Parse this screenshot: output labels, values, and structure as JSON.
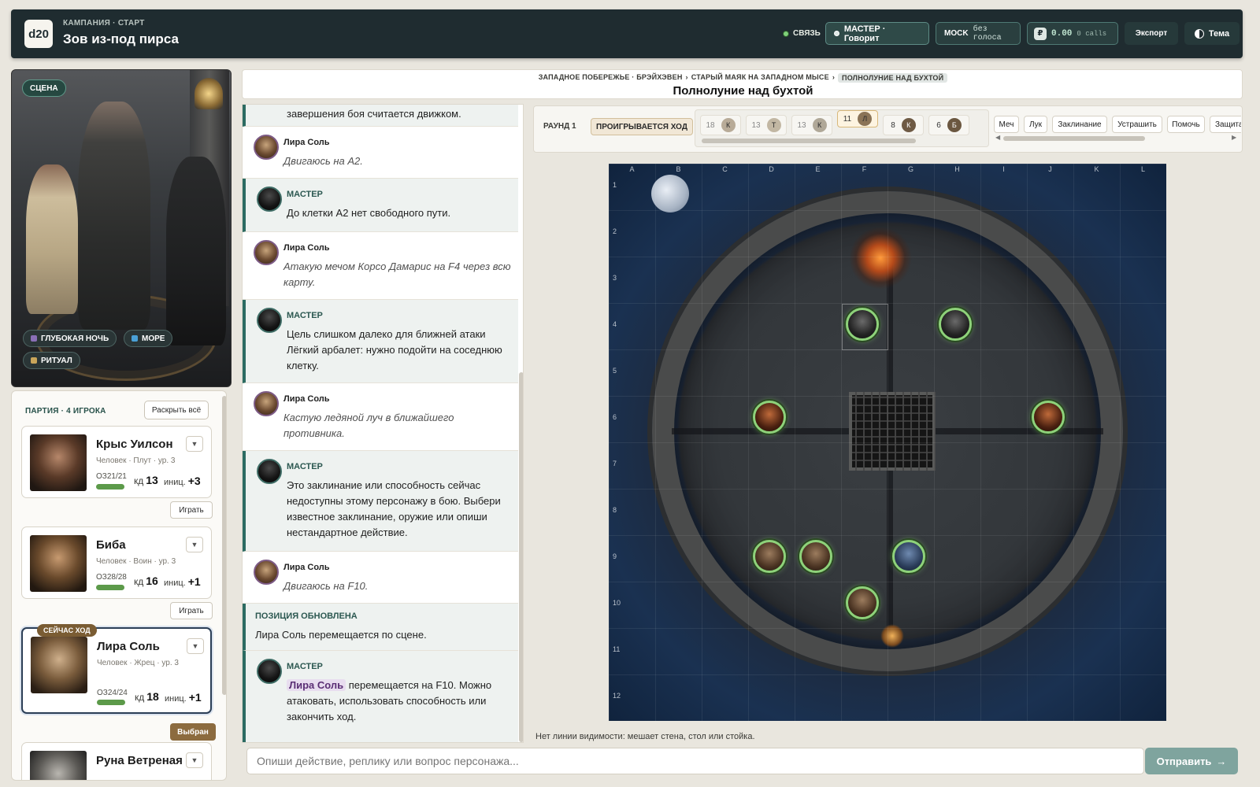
{
  "header": {
    "logo": "d20",
    "campaign_label": "КАМПАНИЯ · СТАРТ",
    "campaign_title": "Зов из-под пирса",
    "connection": "СВЯЗЬ",
    "master_status": "МАСТЕР · Говорит",
    "mock_label": "MOCK",
    "mock_voice": "без голоса",
    "currency_icon": "₽",
    "cost": "0.00",
    "calls": "0 calls",
    "export": "Экспорт",
    "theme": "Тема"
  },
  "scene": {
    "tag": "СЦЕНА",
    "chips": [
      {
        "label": "ГЛУБОКАЯ НОЧЬ",
        "icon": "night-icon",
        "color": "#8a6fb6"
      },
      {
        "label": "МОРЕ",
        "icon": "sea-icon",
        "color": "#4aa0d6"
      },
      {
        "label": "РИТУАЛ",
        "icon": "ritual-icon",
        "color": "#c9a55a"
      }
    ]
  },
  "party": {
    "title": "ПАРТИЯ · 4 ИГРОКА",
    "expand": "Раскрыть всё",
    "current_badge": "СЕЙЧАС ХОД",
    "members": [
      {
        "name": "Крыс Уилсон",
        "class": "Человек · Плут · ур. 3",
        "hp": "ОЗ21/21",
        "hp_fraction": 1.0,
        "kd_label": "кд",
        "kd": "13",
        "ini_label": "иниц.",
        "ini": "+3",
        "button": "Играть"
      },
      {
        "name": "Биба",
        "class": "Человек · Воин · ур. 3",
        "hp": "ОЗ28/28",
        "hp_fraction": 1.0,
        "kd_label": "кд",
        "kd": "16",
        "ini_label": "иниц.",
        "ini": "+1",
        "button": "Играть"
      },
      {
        "name": "Лира Соль",
        "class": "Человек · Жрец · ур. 3",
        "hp": "ОЗ24/24",
        "hp_fraction": 1.0,
        "kd_label": "кд",
        "kd": "18",
        "ini_label": "иниц.",
        "ini": "+1",
        "button": "Выбран"
      },
      {
        "name": "Руна Ветреная"
      }
    ]
  },
  "breadcrumbs": [
    "ЗАПАДНОЕ ПОБЕРЕЖЬЕ · БРЭЙХЭВЕН",
    "СТАРЫЙ МАЯК НА ЗАПАДНОМ МЫСЕ",
    "ПОЛНОЛУНИЕ НАД БУХТОЙ"
  ],
  "crumb_sep": "›",
  "scene_title": "Полнолуние над бухтой",
  "chat": [
    {
      "kind": "master-cont",
      "text": "завершения боя считается движком."
    },
    {
      "kind": "user",
      "name": "Лира Соль",
      "text": "Двигаюсь на A2."
    },
    {
      "kind": "master",
      "name": "МАСТЕР",
      "text": "До клетки A2 нет свободного пути."
    },
    {
      "kind": "user",
      "name": "Лира Соль",
      "text": "Атакую мечом Корсо Дамарис на F4 через всю карту."
    },
    {
      "kind": "master",
      "name": "МАСТЕР",
      "text": "Цель слишком далеко для ближней атаки Лёгкий арбалет: нужно подойти на соседнюю клетку."
    },
    {
      "kind": "user",
      "name": "Лира Соль",
      "text": "Кастую ледяной луч в ближайшего противника."
    },
    {
      "kind": "master",
      "name": "МАСТЕР",
      "text": "Это заклинание или способность сейчас недоступны этому персонажу в бою. Выбери известное заклинание, оружие или опиши нестандартное действие."
    },
    {
      "kind": "user",
      "name": "Лира Соль",
      "text": "Двигаюсь на F10."
    },
    {
      "kind": "position",
      "name": "ПОЗИЦИЯ ОБНОВЛЕНА",
      "text": "Лира Соль перемещается по сцене."
    },
    {
      "kind": "master",
      "name": "МАСТЕР",
      "highlight": "Лира Соль",
      "text": " перемещается на F10. Можно атаковать, использовать способность или закончить ход."
    }
  ],
  "combat": {
    "round": "РАУНД 1",
    "playing": "ПРОИГРЫВАЕТСЯ ХОД",
    "initiative": [
      {
        "value": "18",
        "token": "К",
        "color": "#b8ab98"
      },
      {
        "value": "13",
        "token": "Т",
        "color": "#c2b7a3"
      },
      {
        "value": "13",
        "token": "К",
        "color": "#b0a898"
      },
      {
        "value": "11",
        "token": "Л",
        "color": "#8a7356",
        "active": true
      },
      {
        "value": "8",
        "token": "К",
        "color": "#6e5a44"
      },
      {
        "value": "6",
        "token": "Б",
        "color": "#6b5740"
      }
    ],
    "actions": [
      "Меч",
      "Лук",
      "Заклинание",
      "Устрашить",
      "Помочь",
      "Защита"
    ]
  },
  "map": {
    "columns": [
      "A",
      "B",
      "C",
      "D",
      "E",
      "F",
      "G",
      "H",
      "I",
      "J",
      "K",
      "L"
    ],
    "rows": [
      "1",
      "2",
      "3",
      "4",
      "5",
      "6",
      "7",
      "8",
      "9",
      "10",
      "11",
      "12"
    ],
    "tokens": [
      {
        "cell": "F4",
        "type": "dark"
      },
      {
        "cell": "H4",
        "type": "dark"
      },
      {
        "cell": "D6",
        "type": "enemy"
      },
      {
        "cell": "J6",
        "type": "enemy"
      },
      {
        "cell": "D9",
        "type": "hero"
      },
      {
        "cell": "E9",
        "type": "hero"
      },
      {
        "cell": "G9",
        "type": "blue"
      },
      {
        "cell": "F10",
        "type": "hero"
      }
    ],
    "los_message": "Нет линии видимости: мешает стена, стол или стойка."
  },
  "input": {
    "placeholder": "Опиши действие, реплику или вопрос персонажа...",
    "send": "Отправить",
    "send_arrow": "→"
  }
}
